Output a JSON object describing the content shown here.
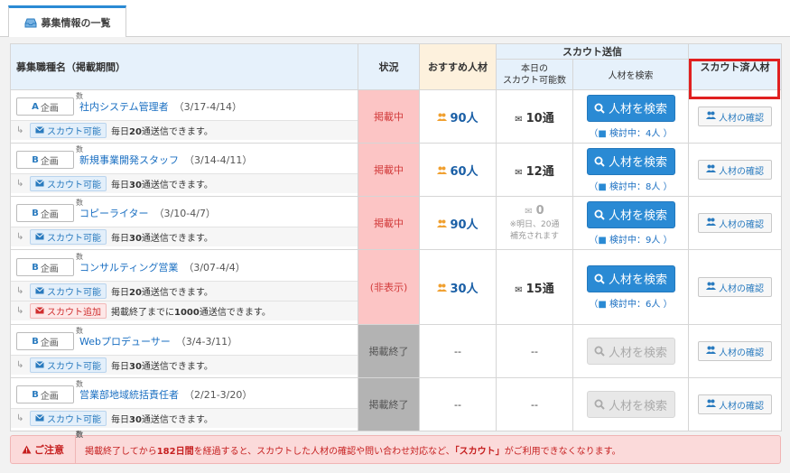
{
  "tab": {
    "label": "募集情報の一覧"
  },
  "headers": {
    "job": "募集職種名（掲載期間）",
    "status": "状況",
    "recommended": "おすすめ人材",
    "scout_send": "スカウト送信",
    "today_line1": "本日の",
    "today_line2": "スカウト可能数",
    "search": "人材を検索",
    "scouted": "スカウト済人材"
  },
  "rows": [
    {
      "plan_letter": "A",
      "plan_text": "企画",
      "sup": "数",
      "name": "社内システム管理者",
      "period": "（3/17-4/14）",
      "subs": [
        {
          "pill": "スカウト可能",
          "pre": "毎日",
          "num": "20",
          "post": "通送信できます。"
        }
      ],
      "status": "掲載中",
      "recommended_count": "90人",
      "today": "10通",
      "search_label": "人材を検索",
      "reviewing": "検討中：4人",
      "confirm_label": "人材の確認"
    },
    {
      "plan_letter": "B",
      "plan_text": "企画",
      "sup": "数",
      "name": "新規事業開発スタッフ",
      "period": "（3/14-4/11）",
      "subs": [
        {
          "pill": "スカウト可能",
          "pre": "毎日",
          "num": "30",
          "post": "通送信できます。"
        }
      ],
      "status": "掲載中",
      "recommended_count": "60人",
      "today": "12通",
      "search_label": "人材を検索",
      "reviewing": "検討中：8人",
      "confirm_label": "人材の確認"
    },
    {
      "plan_letter": "B",
      "plan_text": "企画",
      "sup": "数",
      "name": "コピーライター",
      "period": "（3/10-4/7）",
      "subs": [
        {
          "pill": "スカウト可能",
          "pre": "毎日",
          "num": "30",
          "post": "通送信できます。"
        }
      ],
      "status": "掲載中",
      "recommended_count": "90人",
      "today": "0",
      "today_note1": "※明日、20通",
      "today_note2": "補充されます",
      "search_label": "人材を検索",
      "reviewing": "検討中：9人",
      "confirm_label": "人材の確認"
    },
    {
      "plan_letter": "B",
      "plan_text": "企画",
      "sup": "数",
      "name": "コンサルティング営業",
      "period": "（3/07-4/4）",
      "subs": [
        {
          "pill": "スカウト可能",
          "pre": "毎日",
          "num": "20",
          "post": "通送信できます。"
        },
        {
          "pill": "スカウト追加",
          "pre": "掲載終了までに",
          "num": "1000",
          "post": "通送信できます。"
        }
      ],
      "status": "(非表示)",
      "recommended_count": "30人",
      "today": "15通",
      "search_label": "人材を検索",
      "reviewing": "検討中：6人",
      "confirm_label": "人材の確認"
    },
    {
      "plan_letter": "B",
      "plan_text": "企画",
      "sup": "数",
      "name": "Webプロデューサー",
      "period": "（3/4-3/11）",
      "subs": [
        {
          "pill": "スカウト可能",
          "pre": "毎日",
          "num": "30",
          "post": "通送信できます。"
        }
      ],
      "status": "掲載終了",
      "recommended_count": "--",
      "today": "--",
      "search_label": "人材を検索",
      "confirm_label": "人材の確認"
    },
    {
      "plan_letter": "B",
      "plan_text": "企画",
      "sup": "数",
      "name": "営業部地域統括責任者",
      "period": "（2/21-3/20）",
      "subs": [
        {
          "pill": "スカウト可能",
          "pre": "毎日",
          "num": "30",
          "post": "通送信できます。"
        }
      ],
      "status": "掲載終了",
      "recommended_count": "--",
      "today": "--",
      "search_label": "人材を検索",
      "confirm_label": "人材の確認"
    }
  ],
  "caution": {
    "label": "ご注意",
    "sup": "数",
    "pre": "掲載終了してから",
    "days": "182日間",
    "mid": "を経過すると、スカウトした人材の確認や問い合わせ対応など、",
    "scout": "「スカウト」",
    "post": "がご利用できなくなります。"
  },
  "colors": {
    "accent": "#2a8ad4",
    "live": "#fcc5c5",
    "ended": "#b3b3b3",
    "highlight": "#e02020"
  }
}
